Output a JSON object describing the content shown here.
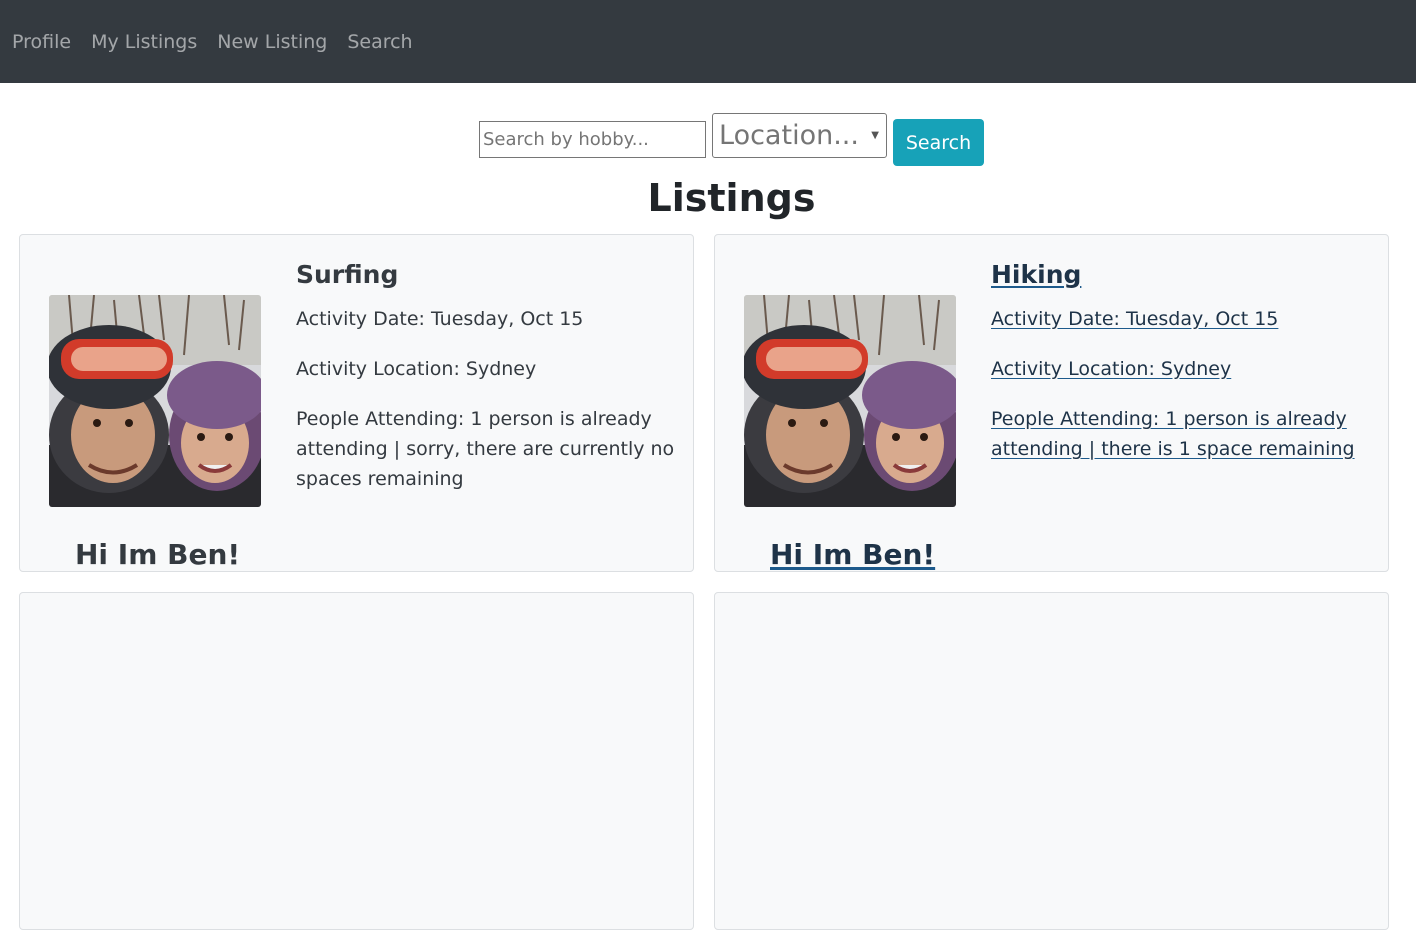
{
  "nav": {
    "items": [
      {
        "label": "Profile"
      },
      {
        "label": "My Listings"
      },
      {
        "label": "New Listing"
      },
      {
        "label": "Search"
      }
    ]
  },
  "search": {
    "hobby_placeholder": "Search by hobby...",
    "hobby_value": "",
    "location_selected": "Location...",
    "button_label": "Search"
  },
  "page_title": "Listings",
  "listings": [
    {
      "hobby": "Surfing",
      "date": "Activity Date: Tuesday, Oct 15",
      "location": "Activity Location: Sydney",
      "attending": "People Attending: 1 person is already attending | sorry, there are currently no spaces remaining",
      "greeting": "Hi Im Ben!"
    },
    {
      "hobby": "Hiking",
      "date": "Activity Date: Tuesday, Oct 15",
      "location": "Activity Location: Sydney",
      "attending": "People Attending: 1 person is already attending | there is 1 space remaining",
      "greeting": "Hi Im Ben!"
    }
  ],
  "colors": {
    "navbar_bg": "#343a40",
    "search_button": "#17a2b8",
    "card_bg": "#f8f9fa",
    "link": "#1d5a8c"
  }
}
